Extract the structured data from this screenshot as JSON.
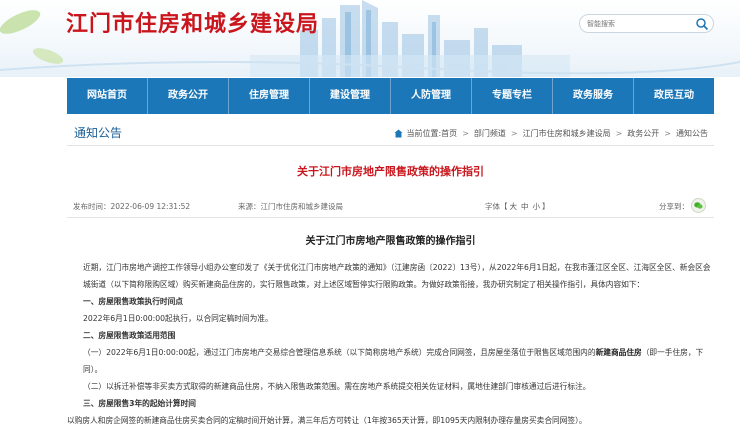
{
  "header": {
    "site_title": "江门市住房和城乡建设局",
    "search_placeholder": "智能搜索"
  },
  "nav": {
    "items": [
      "网站首页",
      "政务公开",
      "住房管理",
      "建设管理",
      "人防管理",
      "专题专栏",
      "政务服务",
      "政民互动"
    ]
  },
  "crumb": {
    "section_title": "通知公告",
    "items": [
      "当前位置:首页",
      "部门频道",
      "江门市住房和城乡建设局",
      "政务公开",
      "通知公告"
    ]
  },
  "article": {
    "title": "关于江门市房地产限售政策的操作指引",
    "date": "发布时间：2022-06-09 12:31:52",
    "source": "来源：江门市住房和城乡建设局",
    "font_label": "字体【",
    "font_big": "大",
    "font_mid": "中",
    "font_small": "小",
    "font_end": "】",
    "share_label": "分享到："
  },
  "doc": {
    "title": "关于江门市房地产限售政策的操作指引",
    "intro": "近期，江门市房地产调控工作领导小组办公室印发了《关于优化江门市房地产政策的通知》（江建房函〔2022〕13号），从2022年6月1日起，在我市蓬江区全区、江海区全区、新会区会城街道（以下简称限购区域）购买新建商品住房的，实行限售政策，对上述区域暂停实行限购政策。为做好政策衔接，我办研究制定了相关操作指引，具体内容如下：",
    "h1": "一、房屋限售政策执行时间点",
    "p1": "2022年6月1日0:00:00起执行，以合同定稿时间为准。",
    "h2": "二、房屋限售政策适用范围",
    "p2a": "（一）2022年6月1日0:00:00起，通过江门市房地产交易综合管理信息系统（以下简称房地产系统）完成合同网签，且房屋坐落位于限售区域范围内的",
    "p2a_bold": "新建商品住房",
    "p2a_tail": "（即一手住房，下同）。",
    "p2b": "（二）以拆迁补偿等非买卖方式取得的新建商品住房，不纳入限售政策范围。需在房地产系统提交相关佐证材料，属地住建部门审核通过后进行标注。",
    "h3": "三、房屋限售3年的起始计算时间",
    "p3": "以购房人和房企网签的新建商品住房买卖合同的定稿时间开始计算，满三年后方可转让（1年按365天计算，即1095天内限制办理存量房买卖合同网签）。"
  }
}
